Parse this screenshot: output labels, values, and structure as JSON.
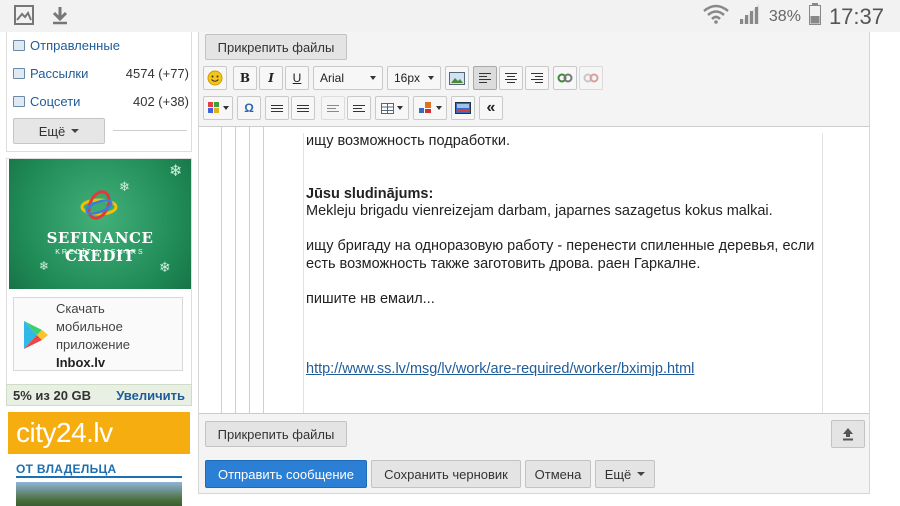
{
  "status_bar": {
    "battery": "38%",
    "time": "17:37"
  },
  "sidebar": {
    "folders": [
      {
        "name": "Отправленные",
        "count": ""
      },
      {
        "name": "Рассылки",
        "count": "4574 (+77)"
      },
      {
        "name": "Соцсети",
        "count": "402 (+38)"
      }
    ],
    "more_label": "Ещё"
  },
  "ad": {
    "brand_main": "SEFINANCE CREDIT",
    "brand_sub": "KREDĪTU CENTRS",
    "app_line1": "Скачать",
    "app_line2": "мобильное",
    "app_line3": "приложение",
    "app_name": "Inbox.lv"
  },
  "storage": {
    "used": "5% из 20 GB",
    "increase": "Увеличить"
  },
  "city24": {
    "text": "city24.lv"
  },
  "owner": {
    "label": "ОТ ВЛАДЕЛЬЦА"
  },
  "compose": {
    "attach_label": "Прикрепить файлы",
    "font_family": "Arial",
    "font_size": "16px",
    "body": {
      "line_top": "ищу возможность подработки.",
      "heading": "Jūsu sludinājums:",
      "lv_text": "Mekleju brigadu vienreizejam darbam, japarnes sazagetus kokus malkai.",
      "ru_line1": "ищу бригаду на одноразовую работу - перенести спиленные деревья, если",
      "ru_line2": "есть возможность также заготовить дрова. раен Гаркалне.",
      "write_email": "пишите нв емаил...",
      "link": "http://www.ss.lv/msg/lv/work/are-required/worker/bximjp.html"
    },
    "send_label": "Отправить сообщение",
    "draft_label": "Сохранить черновик",
    "cancel_label": "Отмена",
    "more_label": "Ещё"
  },
  "colors": {
    "accent": "#2b7fd4",
    "link": "#1f5c99",
    "storage_bg": "#e8f0e4",
    "city24": "#f6ad10",
    "ad_green": "#1f8a56"
  }
}
